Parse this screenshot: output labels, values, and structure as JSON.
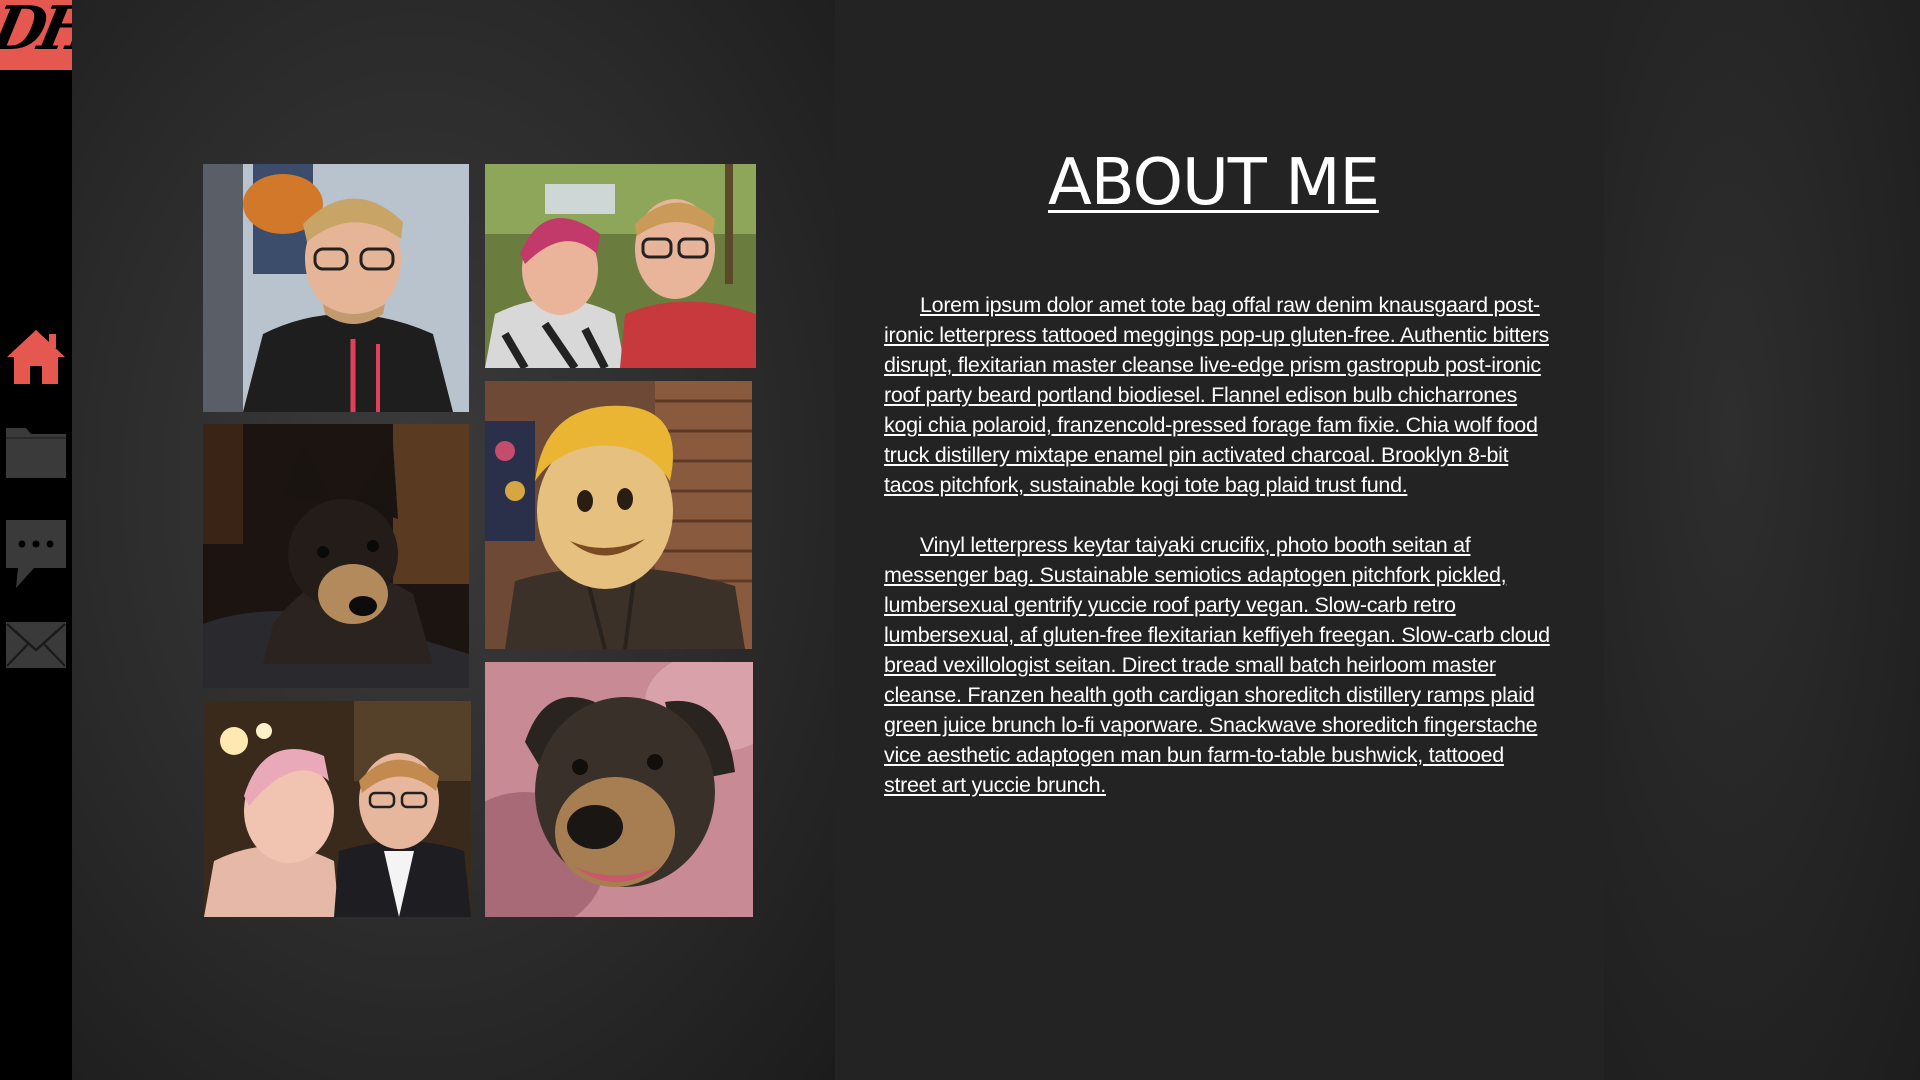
{
  "logo": {
    "text": "DH",
    "color": "#e4584f"
  },
  "nav": [
    {
      "name": "home",
      "icon": "home-icon",
      "active": true,
      "color": "#e4584f"
    },
    {
      "name": "projects",
      "icon": "folder-icon",
      "active": false,
      "color": "#3a3a3a"
    },
    {
      "name": "chat",
      "icon": "chat-bubble-icon",
      "active": false,
      "color": "#3a3a3a"
    },
    {
      "name": "contact",
      "icon": "envelope-icon",
      "active": false,
      "color": "#3a3a3a"
    }
  ],
  "gallery": [
    {
      "id": "selfie",
      "label": ""
    },
    {
      "id": "couple-outdoors",
      "label": ""
    },
    {
      "id": "dog-dark",
      "label": ""
    },
    {
      "id": "vault-boy-mask",
      "label": ""
    },
    {
      "id": "couple-evening",
      "label": ""
    },
    {
      "id": "dog-closeup",
      "label": ""
    }
  ],
  "about": {
    "title": "ABOUT ME",
    "paragraphs": [
      "Lorem ipsum dolor amet tote bag offal raw denim knausgaard post-ironic letterpress tattooed meggings pop-up gluten-free. Authentic bitters disrupt, flexitarian master cleanse live-edge prism gastropub post-ironic roof party beard portland biodiesel. Flannel edison bulb chicharrones kogi chia polaroid, franzencold-pressed forage fam fixie. Chia wolf food truck distillery mixtape enamel pin activated charcoal. Brooklyn 8-bit tacos pitchfork, sustainable kogi tote bag plaid trust fund.",
      "Vinyl letterpress keytar taiyaki crucifix, photo booth seitan af messenger bag. Sustainable semiotics adaptogen pitchfork pickled, lumbersexual gentrify yuccie roof party vegan. Slow-carb retro lumbersexual, af gluten-free flexitarian keffiyeh freegan. Slow-carb cloud bread vexillologist seitan. Direct trade small batch heirloom master cleanse. Franzen health goth cardigan shoreditch distillery ramps plaid green juice brunch lo-fi vaporware. Snackwave shoreditch fingerstache vice aesthetic adaptogen man bun farm-to-table bushwick, tattooed street art yuccie brunch."
    ]
  }
}
